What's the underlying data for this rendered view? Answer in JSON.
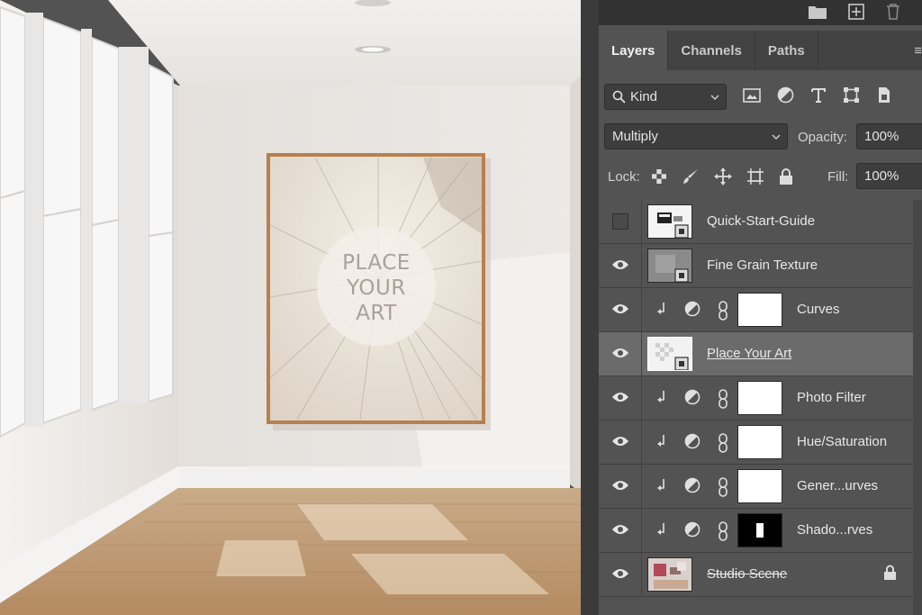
{
  "canvas": {
    "art_label_lines": [
      "PLACE",
      "YOUR",
      "ART"
    ]
  },
  "panel": {
    "top_icons": [
      "folder-icon",
      "new-layer-icon",
      "trash-icon"
    ],
    "tabs": [
      {
        "label": "Layers",
        "active": true
      },
      {
        "label": "Channels",
        "active": false
      },
      {
        "label": "Paths",
        "active": false
      }
    ],
    "tab_menu": "≡",
    "filter": {
      "kind_label": "Kind",
      "icons": [
        "image-filter-icon",
        "adjustment-filter-icon",
        "type-filter-icon",
        "shape-filter-icon",
        "smart-object-filter-icon"
      ]
    },
    "blend": {
      "mode": "Multiply",
      "opacity_label": "Opacity:",
      "opacity_value": "100%"
    },
    "lock": {
      "label": "Lock:",
      "icons": [
        "lock-transparent-icon",
        "lock-paint-icon",
        "lock-position-icon",
        "lock-artboard-icon",
        "lock-all-icon"
      ],
      "fill_label": "Fill:",
      "fill_value": "100%"
    },
    "layers": [
      {
        "name": "Quick-Start-Guide",
        "visible": false,
        "type": "smart"
      },
      {
        "name": "Fine Grain Texture",
        "visible": true,
        "type": "smart-gray"
      },
      {
        "name": "Curves",
        "visible": true,
        "type": "adjustment",
        "mask": "white"
      },
      {
        "name": "Place Your Art",
        "visible": true,
        "type": "smart-art",
        "selected": true
      },
      {
        "name": "Photo Filter",
        "visible": true,
        "type": "adjustment",
        "mask": "white"
      },
      {
        "name": "Hue/Saturation",
        "visible": true,
        "type": "adjustment",
        "mask": "white"
      },
      {
        "name": "Gener...urves",
        "visible": true,
        "type": "adjustment",
        "mask": "white"
      },
      {
        "name": "Shado...rves",
        "visible": true,
        "type": "adjustment",
        "mask": "black"
      },
      {
        "name": "Studio Scene",
        "visible": true,
        "type": "scene",
        "locked": true
      }
    ]
  }
}
